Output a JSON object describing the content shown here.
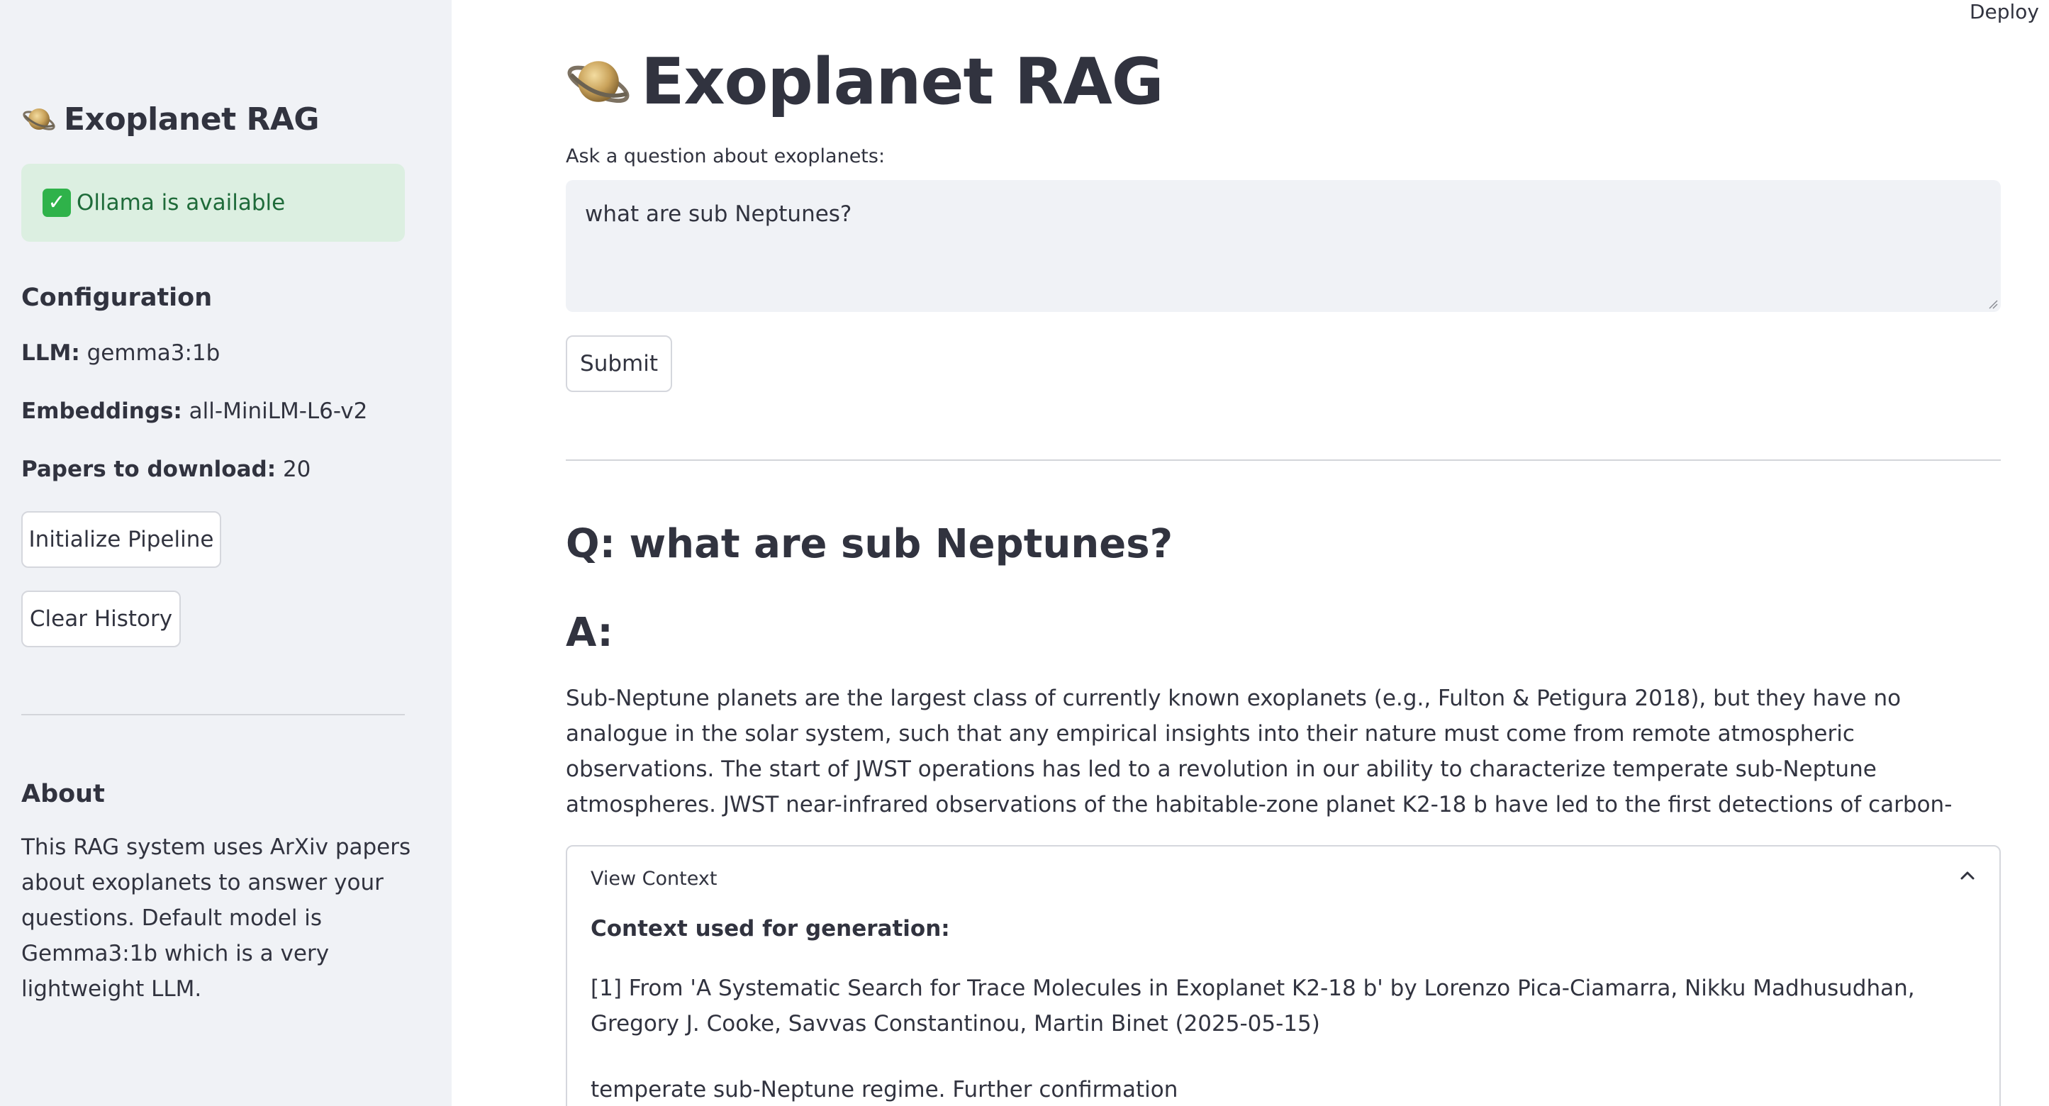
{
  "header": {
    "deploy_label": "Deploy"
  },
  "sidebar": {
    "title": "Exoplanet RAG",
    "status": "Ollama is available",
    "config_heading": "Configuration",
    "config": [
      {
        "label": "LLM:",
        "value": "gemma3:1b"
      },
      {
        "label": "Embeddings:",
        "value": "all-MiniLM-L6-v2"
      },
      {
        "label": "Papers to download:",
        "value": "20"
      }
    ],
    "init_button": "Initialize Pipeline",
    "clear_button": "Clear History",
    "about_heading": "About",
    "about_text": "This RAG system uses ArXiv papers about exoplanets to answer your questions. Default model is Gemma3:1b which is a very lightweight LLM."
  },
  "main": {
    "title": "Exoplanet RAG",
    "question_label": "Ask a question about exoplanets:",
    "question_value": "what are sub Neptunes?",
    "submit_label": "Submit",
    "q_heading": "Q: what are sub Neptunes?",
    "a_heading": "A:",
    "answer": "Sub-Neptune planets are the largest class of currently known exoplanets (e.g., Fulton & Petigura 2018), but they have no analogue in the solar system, such that any empirical insights into their nature must come from remote atmospheric observations. The start of JWST operations has led to a revolution in our ability to characterize temperate sub-Neptune atmospheres. JWST near-infrared observations of the habitable-zone planet K2-18 b have led to the first detections of carbon-",
    "context": {
      "header": "View Context",
      "title": "Context used for generation:",
      "ref": "[1] From 'A Systematic Search for Trace Molecules in Exoplanet K2-18 b' by Lorenzo Pica-Ciamarra, Nikku Madhusudhan, Gregory J. Cooke, Savvas Constantinou, Martin Binet (2025-05-15)",
      "snippet": "temperate sub-Neptune regime. Further confirmation"
    }
  },
  "icons": {
    "logo": "ringed-planet-icon",
    "status": "check-mark-icon",
    "expander": "chevron-up-icon"
  },
  "colors": {
    "sidebar_bg": "#f0f2f6",
    "success_bg": "#dcefe1",
    "success_text": "#1f6b3a"
  }
}
